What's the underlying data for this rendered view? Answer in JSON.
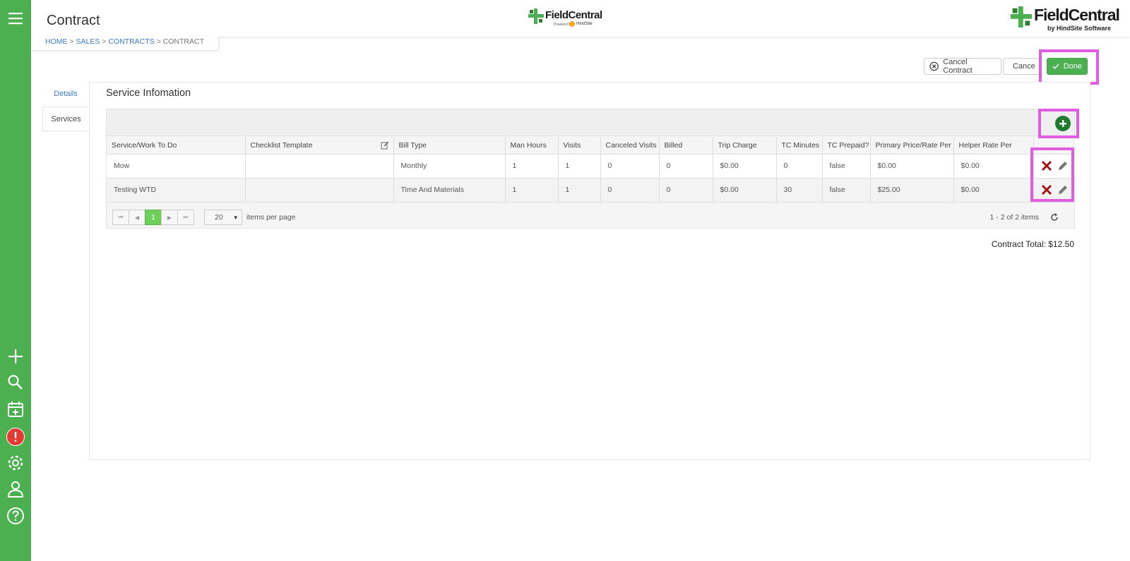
{
  "header": {
    "title": "Contract"
  },
  "breadcrumb": {
    "home": "HOME",
    "sales": "SALES",
    "contracts": "CONTRACTS",
    "current": "CONTRACT",
    "sep": ">"
  },
  "brand": {
    "name": "FieldCentral",
    "powered_by": "Powered By",
    "hindsite": "HindSite",
    "byline": "by HindSite Software",
    "green": "#4caf50"
  },
  "sidebar": {
    "icons": [
      "menu-icon",
      "plus-icon",
      "search-icon",
      "calendar-add-icon",
      "alert-icon",
      "gear-icon",
      "user-icon",
      "help-icon"
    ]
  },
  "actions": {
    "cancel_contract": "Cancel Contract",
    "cancel": "Cance",
    "done": "Done"
  },
  "tabs": [
    {
      "label": "Details"
    },
    {
      "label": "Services"
    }
  ],
  "section": {
    "title": "Service Infomation"
  },
  "table": {
    "columns": [
      "Service/Work To Do",
      "Checklist Template",
      "Bill Type",
      "Man Hours",
      "Visits",
      "Canceled Visits",
      "Billed",
      "Trip Charge",
      "TC Minutes",
      "TC Prepaid?",
      "Primary Price/Rate Per",
      "Helper Rate Per"
    ],
    "rows": [
      [
        "Mow",
        "",
        "Monthly",
        "1",
        "1",
        "0",
        "0",
        "$0.00",
        "0",
        "false",
        "$0.00",
        "$0.00"
      ],
      [
        "Testing WTD",
        "",
        "Time And Materials",
        "1",
        "1",
        "0",
        "0",
        "$0.00",
        "30",
        "false",
        "$25.00",
        "$0.00"
      ]
    ]
  },
  "pager": {
    "current_page": "1",
    "page_size": "20",
    "items_per_page": "items per page",
    "summary": "1 - 2 of 2 items"
  },
  "total": {
    "label": "Contract Total: $12.50"
  }
}
